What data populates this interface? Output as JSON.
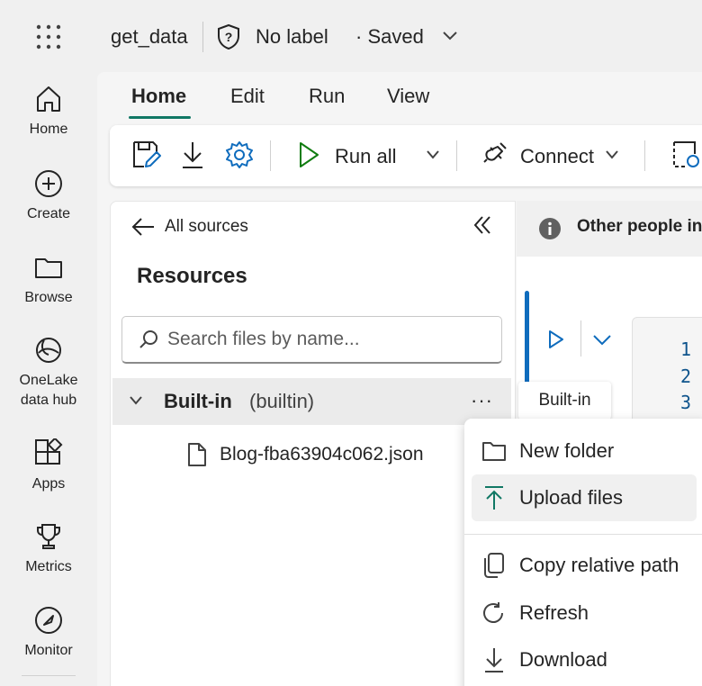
{
  "topbar": {
    "item_name": "get_data",
    "sensitivity_label": "No label",
    "save_status": "· Saved"
  },
  "rail": {
    "items": [
      {
        "label": "Home",
        "icon": "home-icon"
      },
      {
        "label": "Create",
        "icon": "plus-circle-icon"
      },
      {
        "label": "Browse",
        "icon": "folder-icon"
      },
      {
        "label": "OneLake\ndata hub",
        "icon": "onelake-icon"
      },
      {
        "label": "Apps",
        "icon": "apps-icon"
      },
      {
        "label": "Metrics",
        "icon": "trophy-icon"
      },
      {
        "label": "Monitor",
        "icon": "monitor-icon"
      }
    ]
  },
  "tabs": [
    "Home",
    "Edit",
    "Run",
    "View"
  ],
  "ribbon": {
    "run_all": "Run all",
    "connect": "Connect"
  },
  "explorer": {
    "back_label": "All sources",
    "title": "Resources",
    "search_placeholder": "Search files by name...",
    "folder": {
      "name": "Built-in",
      "sub": "(builtin)",
      "more": "···"
    },
    "file": "Blog-fba63904c062.json"
  },
  "notebook": {
    "info_text": "Other people in",
    "line_numbers": [
      "1",
      "2",
      "3"
    ],
    "tooltip": "Built-in"
  },
  "context_menu": {
    "items": [
      {
        "label": "New folder",
        "icon": "folder-icon"
      },
      {
        "label": "Upload files",
        "icon": "upload-icon"
      },
      {
        "label": "Copy relative path",
        "icon": "copy-icon"
      },
      {
        "label": "Refresh",
        "icon": "refresh-icon"
      },
      {
        "label": "Download",
        "icon": "download-icon"
      }
    ]
  },
  "colors": {
    "accent": "#117865",
    "link_blue": "#0f6cbd",
    "run_green": "#107c10"
  }
}
